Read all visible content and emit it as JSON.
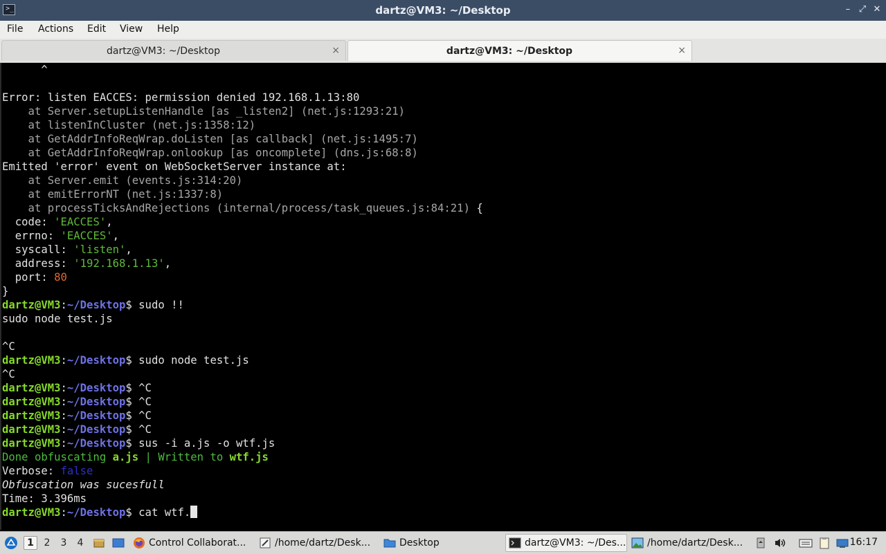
{
  "window": {
    "title": "dartz@VM3: ~/Desktop",
    "buttons": {
      "minimize": "–",
      "restore": "⤢",
      "close": "✕"
    }
  },
  "menu": [
    "File",
    "Actions",
    "Edit",
    "View",
    "Help"
  ],
  "tabs": [
    {
      "label": "dartz@VM3: ~/Desktop",
      "active": false,
      "close": "×"
    },
    {
      "label": "dartz@VM3: ~/Desktop",
      "active": true,
      "close": "×"
    }
  ],
  "terminal": {
    "prompt_user": "dartz@VM3",
    "prompt_path": "~/Desktop",
    "lines": [
      [
        {
          "t": "      ^",
          "c": ""
        }
      ],
      [
        {
          "t": "",
          "c": ""
        }
      ],
      [
        {
          "t": "Error: listen EACCES: permission denied 192.168.1.13:80",
          "c": ""
        }
      ],
      [
        {
          "t": "    at Server.setupListenHandle [as _listen2] (net.js:1293:21)",
          "c": "gray"
        }
      ],
      [
        {
          "t": "    at listenInCluster (net.js:1358:12)",
          "c": "gray"
        }
      ],
      [
        {
          "t": "    at GetAddrInfoReqWrap.doListen [as callback] (net.js:1495:7)",
          "c": "gray"
        }
      ],
      [
        {
          "t": "    at GetAddrInfoReqWrap.onlookup [as oncomplete] (dns.js:68:8)",
          "c": "gray"
        }
      ],
      [
        {
          "t": "Emitted 'error' event on WebSocketServer instance at:",
          "c": ""
        }
      ],
      [
        {
          "t": "    at Server.emit (events.js:314:20)",
          "c": "gray"
        }
      ],
      [
        {
          "t": "    at emitErrorNT (net.js:1337:8)",
          "c": "gray"
        }
      ],
      [
        {
          "t": "    at processTicksAndRejections (internal/process/task_queues.js:84:21)",
          "c": "gray"
        },
        {
          "t": " {",
          "c": ""
        }
      ],
      [
        {
          "t": "  code: ",
          "c": ""
        },
        {
          "t": "'EACCES'",
          "c": "green"
        },
        {
          "t": ",",
          "c": ""
        }
      ],
      [
        {
          "t": "  errno: ",
          "c": ""
        },
        {
          "t": "'EACCES'",
          "c": "green"
        },
        {
          "t": ",",
          "c": ""
        }
      ],
      [
        {
          "t": "  syscall: ",
          "c": ""
        },
        {
          "t": "'listen'",
          "c": "green"
        },
        {
          "t": ",",
          "c": ""
        }
      ],
      [
        {
          "t": "  address: ",
          "c": ""
        },
        {
          "t": "'192.168.1.13'",
          "c": "green"
        },
        {
          "t": ",",
          "c": ""
        }
      ],
      [
        {
          "t": "  port: ",
          "c": ""
        },
        {
          "t": "80",
          "c": "orange"
        }
      ],
      [
        {
          "t": "}",
          "c": ""
        }
      ],
      [
        {
          "t": "dartz@VM3",
          "c": "pg"
        },
        {
          "t": ":",
          "c": ""
        },
        {
          "t": "~/Desktop",
          "c": "pb"
        },
        {
          "t": "$ sudo !!",
          "c": ""
        }
      ],
      [
        {
          "t": "sudo node test.js",
          "c": ""
        }
      ],
      [
        {
          "t": "",
          "c": ""
        }
      ],
      [
        {
          "t": "^C",
          "c": ""
        }
      ],
      [
        {
          "t": "dartz@VM3",
          "c": "pg"
        },
        {
          "t": ":",
          "c": ""
        },
        {
          "t": "~/Desktop",
          "c": "pb"
        },
        {
          "t": "$ sudo node test.js",
          "c": ""
        }
      ],
      [
        {
          "t": "^C",
          "c": ""
        }
      ],
      [
        {
          "t": "dartz@VM3",
          "c": "pg"
        },
        {
          "t": ":",
          "c": ""
        },
        {
          "t": "~/Desktop",
          "c": "pb"
        },
        {
          "t": "$ ^C",
          "c": ""
        }
      ],
      [
        {
          "t": "dartz@VM3",
          "c": "pg"
        },
        {
          "t": ":",
          "c": ""
        },
        {
          "t": "~/Desktop",
          "c": "pb"
        },
        {
          "t": "$ ^C",
          "c": ""
        }
      ],
      [
        {
          "t": "dartz@VM3",
          "c": "pg"
        },
        {
          "t": ":",
          "c": ""
        },
        {
          "t": "~/Desktop",
          "c": "pb"
        },
        {
          "t": "$ ^C",
          "c": ""
        }
      ],
      [
        {
          "t": "dartz@VM3",
          "c": "pg"
        },
        {
          "t": ":",
          "c": ""
        },
        {
          "t": "~/Desktop",
          "c": "pb"
        },
        {
          "t": "$ ^C",
          "c": ""
        }
      ],
      [
        {
          "t": "dartz@VM3",
          "c": "pg"
        },
        {
          "t": ":",
          "c": ""
        },
        {
          "t": "~/Desktop",
          "c": "pb"
        },
        {
          "t": "$ sus -i a.js -o wtf.js",
          "c": ""
        }
      ],
      [
        {
          "t": "Done obfuscating ",
          "c": "dg"
        },
        {
          "t": "a.js",
          "c": "dgb"
        },
        {
          "t": " | Written to ",
          "c": "dg"
        },
        {
          "t": "wtf.js",
          "c": "dgb"
        }
      ],
      [
        {
          "t": "Verbose: ",
          "c": ""
        },
        {
          "t": "false",
          "c": "blue"
        }
      ],
      [
        {
          "t": "Obfuscation was sucesfull",
          "c": "ital"
        }
      ],
      [
        {
          "t": "Time: 3.396ms",
          "c": ""
        }
      ],
      [
        {
          "t": "dartz@VM3",
          "c": "pg"
        },
        {
          "t": ":",
          "c": ""
        },
        {
          "t": "~/Desktop",
          "c": "pb"
        },
        {
          "t": "$ cat wtf.",
          "c": ""
        },
        {
          "t": "",
          "c": "cursor"
        }
      ]
    ]
  },
  "taskbar": {
    "workspaces": [
      "1",
      "2",
      "3",
      "4"
    ],
    "active_workspace": "1",
    "tasks": [
      {
        "label": "Control Collaborat...",
        "icon": "firefox-icon"
      },
      {
        "label": "/home/dartz/Desk...",
        "icon": "text-editor-icon"
      },
      {
        "label": "Desktop",
        "icon": "folder-icon"
      },
      {
        "label": "dartz@VM3: ~/Des...",
        "icon": "terminal-icon",
        "active": true
      },
      {
        "label": "/home/dartz/Desk...",
        "icon": "image-viewer-icon"
      }
    ],
    "clock": "16:17"
  }
}
